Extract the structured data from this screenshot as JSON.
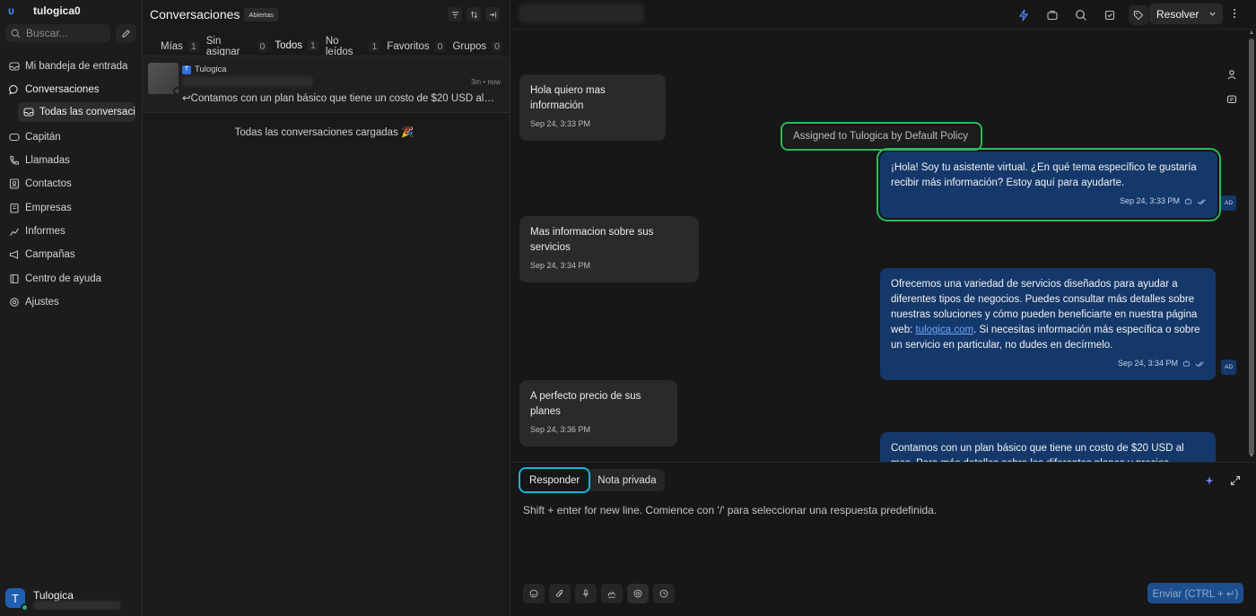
{
  "brand": {
    "logo": "υ",
    "name": "tulogica0"
  },
  "search": {
    "placeholder": "Buscar..."
  },
  "sidebar": {
    "items": [
      {
        "label": "Mi bandeja de entrada",
        "icon": "inbox-icon"
      },
      {
        "label": "Conversaciones",
        "icon": "chat-bubble-icon"
      },
      {
        "label": "Todas las conversaciones",
        "icon": "inbox-icon"
      },
      {
        "label": "Capitán",
        "icon": "captain-icon"
      },
      {
        "label": "Llamadas",
        "icon": "phone-icon"
      },
      {
        "label": "Contactos",
        "icon": "contacts-icon"
      },
      {
        "label": "Empresas",
        "icon": "building-icon"
      },
      {
        "label": "Informes",
        "icon": "chart-icon"
      },
      {
        "label": "Campañas",
        "icon": "megaphone-icon"
      },
      {
        "label": "Centro de ayuda",
        "icon": "book-icon"
      },
      {
        "label": "Ajustes",
        "icon": "gear-icon"
      }
    ]
  },
  "user": {
    "initial": "T",
    "name": "Tulogica"
  },
  "conversations": {
    "title": "Conversaciones",
    "status_badge": "Abiertas",
    "tabs": [
      {
        "label": "Mías",
        "count": "1"
      },
      {
        "label": "Sin asignar",
        "count": "0"
      },
      {
        "label": "Todos",
        "count": "1"
      },
      {
        "label": "No leídos",
        "count": "1"
      },
      {
        "label": "Favoritos",
        "count": "0"
      },
      {
        "label": "Grupos",
        "count": "0"
      }
    ],
    "active_tab": "Todos",
    "item": {
      "inbox_initial": "T",
      "inbox_name": "Tulogica",
      "time": "3m • now",
      "preview": "↩Contamos con un plan básico que tiene un costo de $20 USD al mes. Para más detalles"
    },
    "all_loaded": "Todas las conversaciones cargadas 🎉"
  },
  "chat": {
    "resolve_label": "Resolver",
    "messages": [
      {
        "type": "incoming",
        "text": "Hola quiero mas información",
        "time": "Sep 24, 3:33 PM"
      },
      {
        "type": "activity",
        "text": "Assigned to Tulogica by Default Policy"
      },
      {
        "type": "outgoing",
        "text": "¡Hola! Soy tu asistente virtual. ¿En qué tema específico te gustaría recibir más información? Estoy aquí para ayudarte.",
        "time": "Sep 24, 3:33 PM",
        "sender_tag": "AD"
      },
      {
        "type": "incoming",
        "text": "Mas informacion sobre sus servicios",
        "time": "Sep 24, 3:34 PM"
      },
      {
        "type": "outgoing",
        "text_before": "Ofrecemos una variedad de servicios diseñados para ayudar a diferentes tipos de negocios. Puedes consultar más detalles sobre nuestras soluciones y cómo pueden beneficiarte en nuestra página web: ",
        "link": "tulogica.com",
        "text_after": ". Si necesitas información más específica o sobre un servicio en particular, no dudes en decírmelo.",
        "time": "Sep 24, 3:34 PM",
        "sender_tag": "AD"
      },
      {
        "type": "incoming",
        "text": "A perfecto precio de sus planes",
        "time": "Sep 24, 3:36 PM"
      },
      {
        "type": "outgoing",
        "text": "Contamos con un plan básico que tiene un costo de $20 USD al mes. Para más detalles sobre los diferentes planes y precios, puedes visitar",
        "time": ""
      }
    ]
  },
  "composer": {
    "tabs": [
      "Responder",
      "Nota privada"
    ],
    "placeholder": "Shift + enter for new line. Comience con '/' para seleccionar una respuesta predefinida.",
    "send_label": "Enviar (CTRL + ↵)"
  },
  "colors": {
    "accent": "#2d6fd6",
    "outgoing_bubble": "#15386a",
    "incoming_bubble": "#2a2a2a",
    "highlight_green": "#2ab85f",
    "highlight_cyan": "#17b3d6"
  }
}
